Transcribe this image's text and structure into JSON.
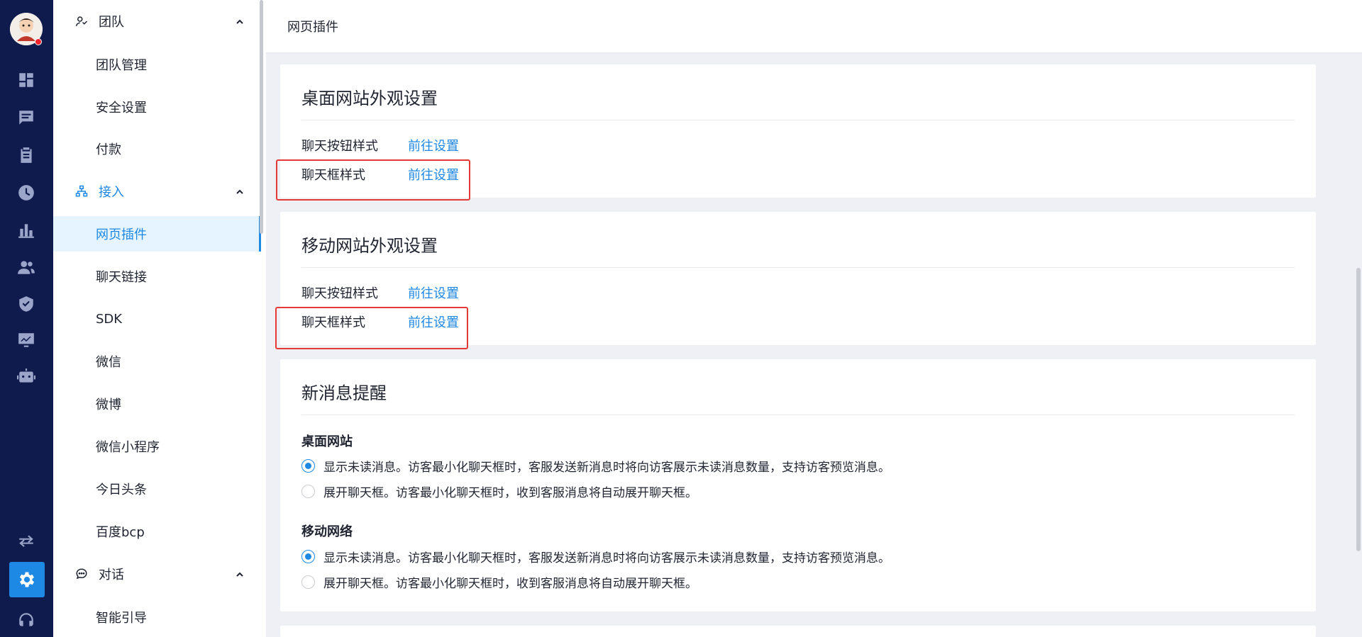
{
  "rail": {
    "icons": [
      "avatar-icon",
      "dashboard-icon",
      "chat-icon",
      "clipboard-icon",
      "clock-icon",
      "bar-chart-icon",
      "people-icon",
      "shield-icon",
      "monitor-chart-icon",
      "robot-icon",
      "transfer-icon",
      "gear-icon",
      "headset-icon"
    ],
    "active": "gear-icon"
  },
  "nav": {
    "groups": {
      "team": {
        "label": "团队"
      },
      "access": {
        "label": "接入"
      },
      "dialog": {
        "label": "对话"
      }
    },
    "team_items": [
      "团队管理",
      "安全设置",
      "付款"
    ],
    "access_items": [
      "网页插件",
      "聊天链接",
      "SDK",
      "微信",
      "微博",
      "微信小程序",
      "今日头条",
      "百度bcp"
    ],
    "dialog_items": [
      "智能引导"
    ],
    "active_item": "网页插件"
  },
  "topbar": {
    "title": "网页插件"
  },
  "desktop_card": {
    "title": "桌面网站外观设置",
    "rows": [
      {
        "label": "聊天按钮样式",
        "link": "前往设置"
      },
      {
        "label": "聊天框样式",
        "link": "前往设置"
      }
    ]
  },
  "mobile_card": {
    "title": "移动网站外观设置",
    "rows": [
      {
        "label": "聊天按钮样式",
        "link": "前往设置"
      },
      {
        "label": "聊天框样式",
        "link": "前往设置"
      }
    ]
  },
  "notify_card": {
    "title": "新消息提醒",
    "sections": [
      {
        "title": "桌面网站",
        "options": [
          {
            "label": "显示未读消息。访客最小化聊天框时，客服发送新消息时将向访客展示未读消息数量，支持访客预览消息。",
            "checked": true
          },
          {
            "label": "展开聊天框。访客最小化聊天框时，收到客服消息将自动展开聊天框。",
            "checked": false
          }
        ]
      },
      {
        "title": "移动网络",
        "options": [
          {
            "label": "显示未读消息。访客最小化聊天框时，客服发送新消息时将向访客展示未读消息数量，支持访客预览消息。",
            "checked": true
          },
          {
            "label": "展开聊天框。访客最小化聊天框时，收到客服消息将自动展开聊天框。",
            "checked": false
          }
        ]
      }
    ]
  },
  "colors": {
    "accent": "#1e88e5",
    "rail_bg": "#0f1b4c",
    "highlight": "#e53935",
    "active_bg": "#e6f4ff"
  }
}
